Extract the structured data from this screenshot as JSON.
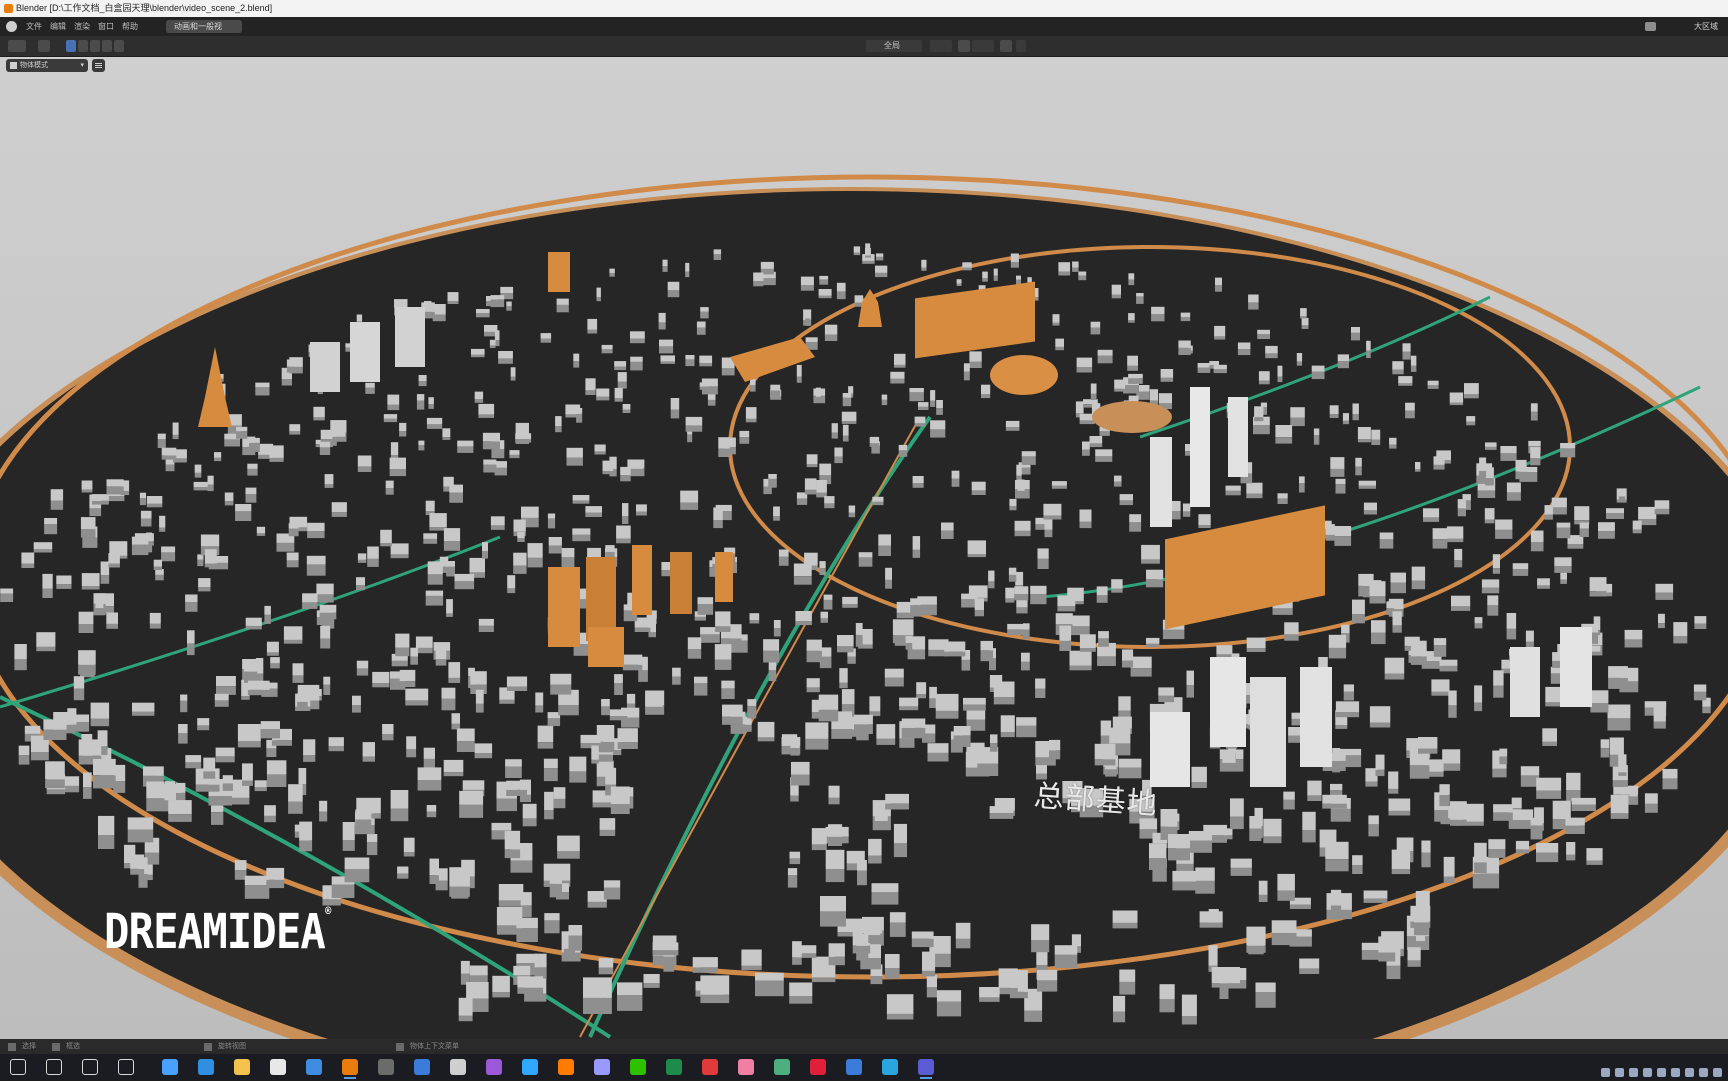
{
  "window": {
    "title": "Blender [D:\\工作文档_白盒园天理\\blender\\video_scene_2.blend]"
  },
  "menubar": {
    "items": [
      "文件",
      "编辑",
      "渲染",
      "窗口",
      "帮助"
    ],
    "workspace_tab": "动画和一般视",
    "scene_name": "大区域"
  },
  "toolbar": {
    "transform_orientation": "全局"
  },
  "viewport": {
    "mode": "物体模式",
    "map_label": "总部基地"
  },
  "watermark": {
    "text": "DREAMIDEA",
    "reg": "®"
  },
  "statusbar": {
    "left_a": "选择",
    "left_b": "框选",
    "center": "旋转视图",
    "right": "物体上下文菜单"
  },
  "colors": {
    "platform_edge": "#d2a06c",
    "ground": "#262626",
    "building": "#c2c2c2",
    "landmark": "#d78b3e",
    "transit_line": "#2fa37a",
    "viewport_bg": "#c9c9c9"
  },
  "taskbar": {
    "icons": [
      "windows-start-icon",
      "search-icon",
      "cortana-icon",
      "task-view-icon",
      "checkmark-app-icon",
      "edge-browser-icon",
      "file-explorer-icon",
      "store-icon",
      "browser-icon",
      "blender-icon",
      "obs-icon",
      "window-app-icon",
      "unity-icon",
      "after-effects-icon",
      "photoshop-icon",
      "illustrator-icon",
      "premiere-icon",
      "wechat-icon",
      "excel-icon",
      "red-app-icon",
      "pink-app-icon",
      "green-app-icon",
      "red-logo-app-icon",
      "blue-app-icon",
      "telegram-icon",
      "visual-studio-icon"
    ]
  }
}
